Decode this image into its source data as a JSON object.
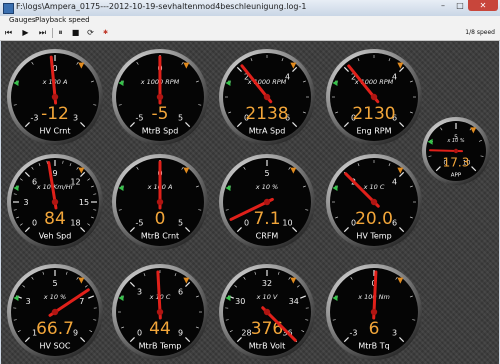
{
  "window": {
    "title": "F:\\logs\\Ampera_0175---2012-10-19-sevhaltenmod4beschleunigung.log-1",
    "close_glyph": "✕",
    "min_glyph": "–",
    "max_glyph": "□"
  },
  "menu": [
    {
      "label": "Gauges"
    },
    {
      "label": "Playback speed"
    }
  ],
  "toolbar": {
    "speed_label": "1/8 speed"
  },
  "gauges": [
    {
      "name": "HV Crnt",
      "display": "-12",
      "scale": "x 100 A",
      "ticks": [
        "-3",
        "0",
        "3"
      ],
      "value": -0.12,
      "min": -3,
      "max": 3,
      "accent": "#e08a1e"
    },
    {
      "name": "MtrB Spd",
      "display": "-5",
      "scale": "x 1000 RPM",
      "ticks": [
        "-5",
        "0",
        "5"
      ],
      "value": -0.005,
      "min": -5,
      "max": 5,
      "accent": "#e08a1e"
    },
    {
      "name": "MtrA Spd",
      "display": "2138",
      "scale": "x 1000 RPM",
      "ticks": [
        "0",
        "2",
        "4",
        "6"
      ],
      "value": 2.138,
      "min": 0,
      "max": 6,
      "accent": "#e08a1e"
    },
    {
      "name": "Eng RPM",
      "display": "2130",
      "scale": "x 1000 RPM",
      "ticks": [
        "0",
        "2",
        "4",
        "6"
      ],
      "value": 2.13,
      "min": 0,
      "max": 6,
      "accent": "#e08a1e"
    },
    {
      "name": "APP",
      "display": "17.3",
      "scale": "x 10 %",
      "ticks": [
        "0",
        "5",
        "10"
      ],
      "value": 1.73,
      "min": 0,
      "max": 10,
      "accent": "#e08a1e"
    },
    {
      "name": "Veh Spd",
      "display": "84",
      "scale": "x 10 Km/Hr",
      "ticks": [
        "0",
        "3",
        "6",
        "9",
        "12",
        "15",
        "18"
      ],
      "value": 8.4,
      "min": 0,
      "max": 18,
      "accent": "#e08a1e"
    },
    {
      "name": "MtrB Crnt",
      "display": "0",
      "scale": "x 100 A",
      "ticks": [
        "-5",
        "0",
        "5"
      ],
      "value": 0,
      "min": -5,
      "max": 5,
      "accent": "#e08a1e"
    },
    {
      "name": "CRFM",
      "display": "7.1",
      "scale": "x 10 %",
      "ticks": [
        "0",
        "5",
        "10"
      ],
      "value": 0.71,
      "min": 0,
      "max": 10,
      "accent": "#e08a1e"
    },
    {
      "name": "HV Temp",
      "display": "20.0",
      "scale": "x 10 C",
      "ticks": [
        "0",
        "2",
        "4",
        "6"
      ],
      "value": 2,
      "min": 0,
      "max": 6,
      "accent": "#e08a1e"
    },
    {
      "name": "HV SOC",
      "display": "66.7",
      "scale": "x 10 %",
      "ticks": [
        "1",
        "3",
        "5",
        "7",
        "9"
      ],
      "value": 6.67,
      "min": 1,
      "max": 9,
      "accent": "#e08a1e"
    },
    {
      "name": "MtrB Temp",
      "display": "44",
      "scale": "x 10 C",
      "ticks": [
        "0",
        "3",
        "6",
        "9"
      ],
      "value": 4.4,
      "min": 0,
      "max": 9,
      "accent": "#e08a1e"
    },
    {
      "name": "MtrB Volt",
      "display": "376",
      "scale": "x 10 V",
      "ticks": [
        "28",
        "30",
        "32",
        "34",
        "36"
      ],
      "value": 37.6,
      "min": 28,
      "max": 36,
      "accent": "#e08a1e"
    },
    {
      "name": "MtrB Tq",
      "display": "6",
      "scale": "x 100 Nm",
      "ticks": [
        "-3",
        "0",
        "3"
      ],
      "value": 0.06,
      "min": -3,
      "max": 3,
      "accent": "#e08a1e"
    }
  ]
}
